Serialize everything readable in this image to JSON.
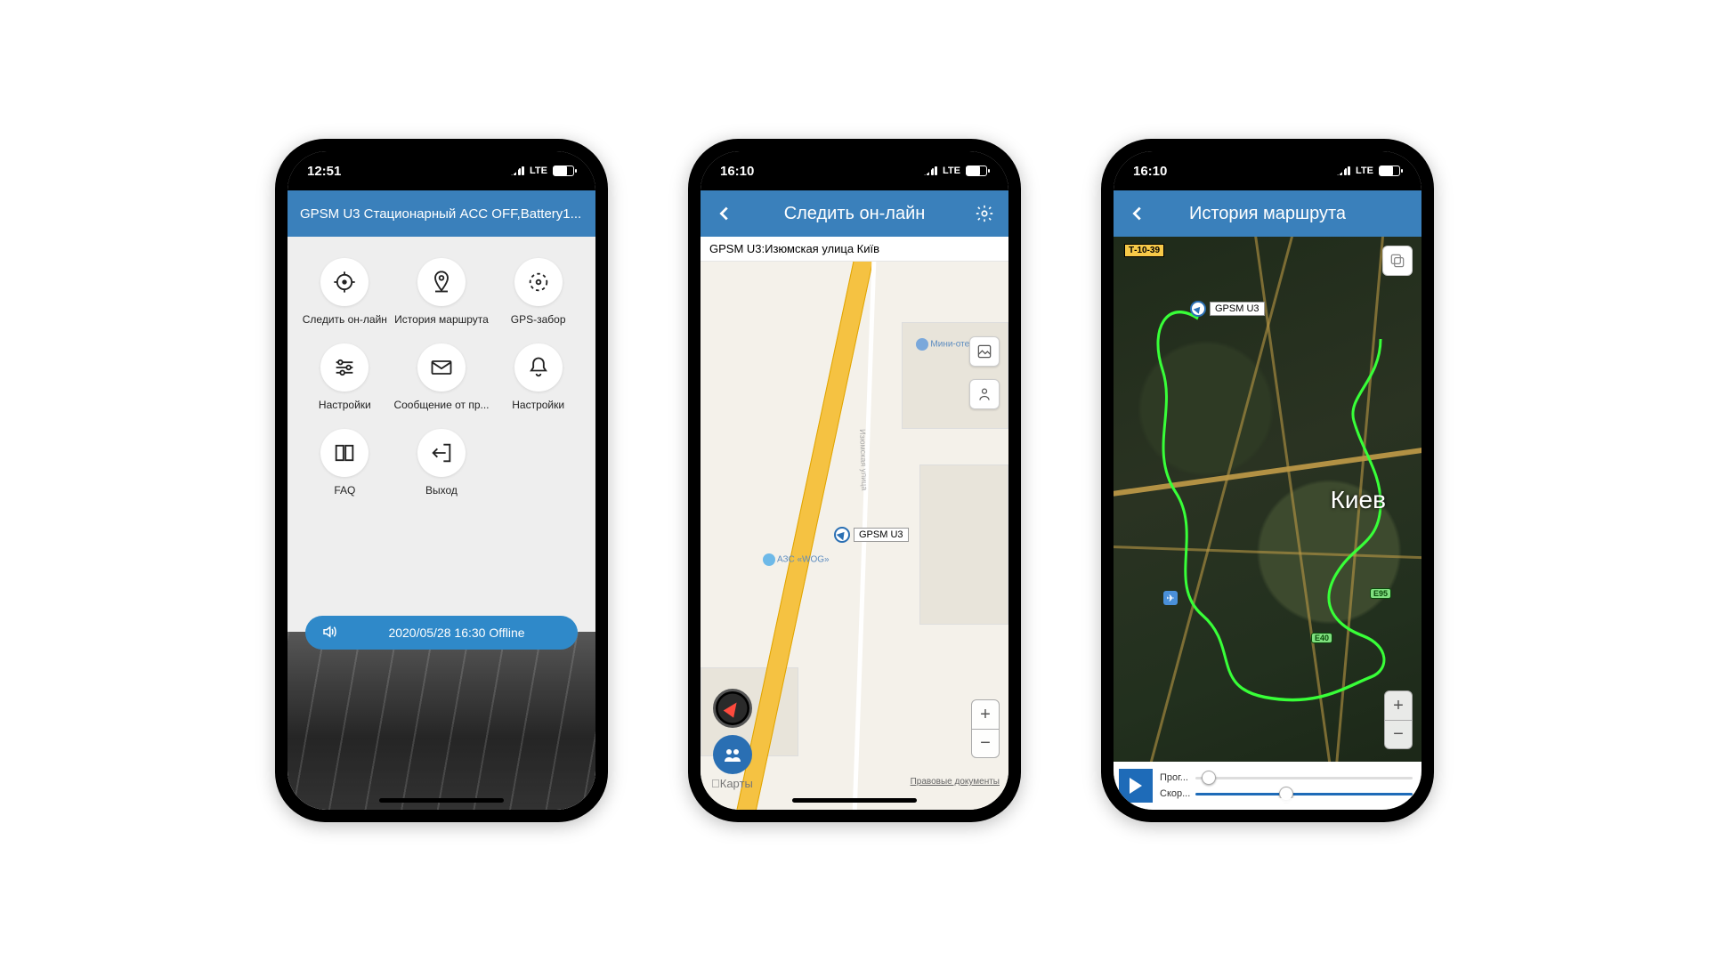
{
  "status": {
    "time1": "12:51",
    "time2": "16:10",
    "time3": "16:10",
    "net": "LTE"
  },
  "phone1": {
    "header": "GPSM U3 Стационарный ACC OFF,Battery1...",
    "items": [
      {
        "label": "Следить он-лайн",
        "icon": "target"
      },
      {
        "label": "История маршрута",
        "icon": "pin"
      },
      {
        "label": "GPS-забор",
        "icon": "fence"
      },
      {
        "label": "Настройки",
        "icon": "sliders"
      },
      {
        "label": "Сообщение от пр...",
        "icon": "mail"
      },
      {
        "label": "Настройки",
        "icon": "bell"
      },
      {
        "label": "FAQ",
        "icon": "book"
      },
      {
        "label": "Выход",
        "icon": "exit"
      }
    ],
    "status_text": "2020/05/28 16:30 Offline"
  },
  "phone2": {
    "title": "Следить он-лайн",
    "location": "GPSM U3:Изюмская улица Київ",
    "marker": "GPSM U3",
    "street": "Изюмская улица",
    "poi_hotel": "Мини-отел...",
    "poi_gas": "АЗС «WOG»",
    "legal": "Правовые документы",
    "maplogo": "Карты"
  },
  "phone3": {
    "title": "История маршрута",
    "marker": "GPSM U3",
    "city": "Киев",
    "route": "Т-10-39",
    "hwy1": "E95",
    "hwy2": "E40",
    "slider1": "Прог...",
    "slider2": "Скор..."
  }
}
